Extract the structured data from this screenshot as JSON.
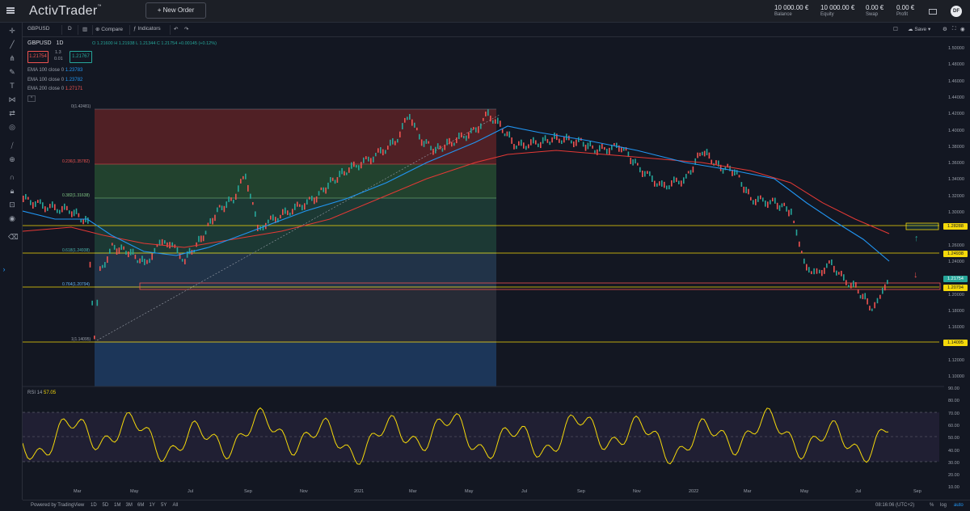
{
  "app": {
    "logo": "ActivTrader",
    "logo_tm": "™",
    "new_order_label": "+ New Order"
  },
  "header_stats": [
    {
      "value": "10 000.00 €",
      "label": "Balance"
    },
    {
      "value": "10 000.00 €",
      "label": "Equity"
    },
    {
      "value": "0.00 €",
      "label": "Swap"
    },
    {
      "value": "0.00 €",
      "label": "Profit"
    }
  ],
  "user": {
    "initials": "DF"
  },
  "toolbar": {
    "symbol": "GBPUSD",
    "interval": "D",
    "compare": "Compare",
    "indicators": "Indicators",
    "save": "Save"
  },
  "legend": {
    "symbol": "GBPUSD",
    "interval": "1D",
    "ohlc": "O 1.21600  H 1.21938  L 1.21344  C 1.21754  +0.00145 (+0.12%)",
    "sell_price": "1.21754",
    "spread_top": "1.3",
    "spread_bottom": "0.01",
    "buy_price": "1.21767",
    "ema100a": {
      "label": "EMA 100 close 0",
      "value": "1.23783"
    },
    "ema100b": {
      "label": "EMA 100 close 0",
      "value": "1.23782"
    },
    "ema200": {
      "label": "EMA 200 close 0",
      "value": "1.27171"
    }
  },
  "fib_labels": [
    {
      "text": "0(1.42481)"
    },
    {
      "text": "0.236(1.35782)"
    },
    {
      "text": "0.382(1.31638)"
    },
    {
      "text": "0.618(1.24938)"
    },
    {
      "text": "0.764(1.20794)"
    },
    {
      "text": "1(1.14095)"
    }
  ],
  "price_axis": [
    "1.50000",
    "1.48000",
    "1.46000",
    "1.44000",
    "1.42000",
    "1.40000",
    "1.38000",
    "1.36000",
    "1.34000",
    "1.32000",
    "1.30000",
    "1.28000",
    "1.26000",
    "1.24000",
    "1.22000",
    "1.20000",
    "1.18000",
    "1.16000",
    "1.14000",
    "1.12000",
    "1.10000"
  ],
  "price_tags": [
    {
      "text": "1.28288",
      "bg": "#f5d90a",
      "fg": "#131722"
    },
    {
      "text": "1.24938",
      "bg": "#f5d90a",
      "fg": "#131722"
    },
    {
      "text": "1.21754",
      "bg": "#26a69a",
      "fg": "#ffffff"
    },
    {
      "text": "1.20794",
      "bg": "#f5d90a",
      "fg": "#131722"
    },
    {
      "text": "1.14095",
      "bg": "#f5d90a",
      "fg": "#131722"
    }
  ],
  "rsi": {
    "label": "RSI 14",
    "value": "57.05",
    "axis": [
      "90.00",
      "80.00",
      "70.00",
      "60.00",
      "50.00",
      "40.00",
      "30.00",
      "20.00",
      "10.00"
    ]
  },
  "time_axis": [
    "Mar",
    "May",
    "Jul",
    "Sep",
    "Nov",
    "2021",
    "Mar",
    "May",
    "Jul",
    "Sep",
    "Nov",
    "2022",
    "Mar",
    "May",
    "Jul",
    "Sep"
  ],
  "bottom": {
    "powered": "Powered by TradingView",
    "ranges": [
      "1D",
      "5D",
      "1M",
      "3M",
      "6M",
      "1Y",
      "5Y",
      "All"
    ],
    "clock": "08:16:06 (UTC+2)",
    "pct": "%",
    "log": "log",
    "auto": "auto"
  },
  "colors": {
    "up": "#26a69a",
    "down": "#ef5350",
    "ema_blue": "#2196f3",
    "ema_red": "#e53935",
    "fib_yellow": "#f5d90a",
    "rsi": "#f5d90a"
  }
}
